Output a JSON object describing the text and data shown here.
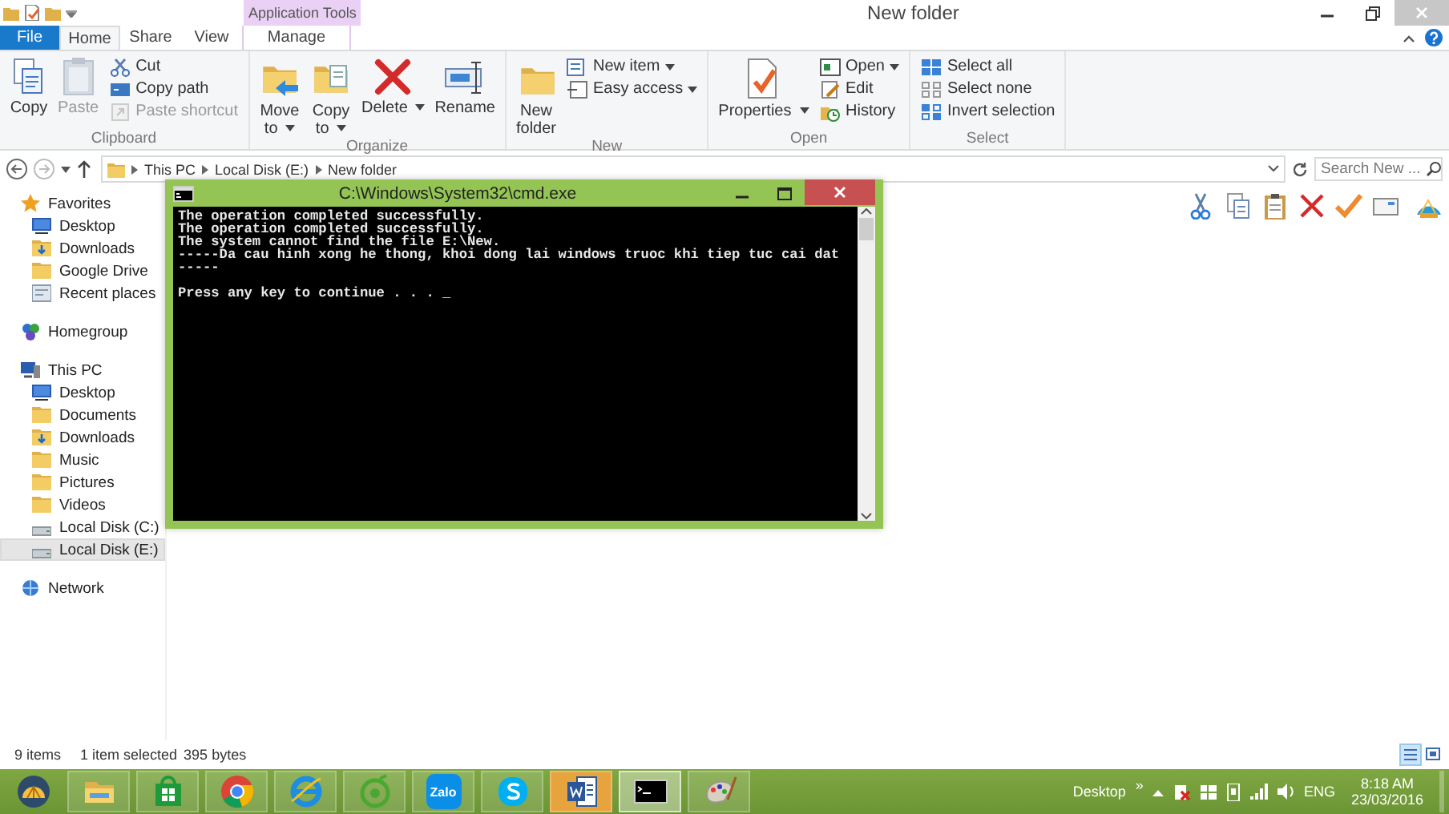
{
  "window": {
    "title": "New folder"
  },
  "context_group": {
    "label": "Application Tools"
  },
  "tabs": [
    {
      "label": "File",
      "kind": "file",
      "selected": false
    },
    {
      "label": "Home",
      "kind": "normal",
      "selected": true
    },
    {
      "label": "Share",
      "kind": "normal",
      "selected": false
    },
    {
      "label": "View",
      "kind": "normal",
      "selected": false
    },
    {
      "label": "Manage",
      "kind": "contextual",
      "selected": false
    }
  ],
  "ribbon": [
    {
      "name": "Clipboard",
      "items": [
        {
          "label": "Copy",
          "kind": "large",
          "disabled": false,
          "dropdown": false
        },
        {
          "label": "Paste",
          "kind": "large",
          "disabled": true,
          "dropdown": false
        },
        {
          "label": "Cut",
          "kind": "small",
          "disabled": false,
          "dropdown": false
        },
        {
          "label": "Copy path",
          "kind": "small",
          "disabled": false,
          "dropdown": false
        },
        {
          "label": "Paste shortcut",
          "kind": "small",
          "disabled": true,
          "dropdown": false
        }
      ]
    },
    {
      "name": "Organize",
      "items": [
        {
          "label": "Move to",
          "kind": "large",
          "disabled": false,
          "dropdown": true
        },
        {
          "label": "Copy to",
          "kind": "large",
          "disabled": false,
          "dropdown": true
        },
        {
          "label": "Delete",
          "kind": "large",
          "disabled": false,
          "dropdown": true
        },
        {
          "label": "Rename",
          "kind": "large",
          "disabled": false,
          "dropdown": false
        }
      ]
    },
    {
      "name": "New",
      "items": [
        {
          "label": "New folder",
          "kind": "large",
          "disabled": false,
          "dropdown": false
        },
        {
          "label": "New item",
          "kind": "small",
          "disabled": false,
          "dropdown": true
        },
        {
          "label": "Easy access",
          "kind": "small",
          "disabled": false,
          "dropdown": true
        }
      ]
    },
    {
      "name": "Open",
      "items": [
        {
          "label": "Properties",
          "kind": "large",
          "disabled": false,
          "dropdown": true
        },
        {
          "label": "Open",
          "kind": "small",
          "disabled": false,
          "dropdown": true
        },
        {
          "label": "Edit",
          "kind": "small",
          "disabled": false,
          "dropdown": false
        },
        {
          "label": "History",
          "kind": "small",
          "disabled": false,
          "dropdown": false
        }
      ]
    },
    {
      "name": "Select",
      "items": [
        {
          "label": "Select all",
          "kind": "small",
          "disabled": false,
          "dropdown": false
        },
        {
          "label": "Select none",
          "kind": "small",
          "disabled": false,
          "dropdown": false
        },
        {
          "label": "Invert selection",
          "kind": "small",
          "disabled": false,
          "dropdown": false
        }
      ]
    }
  ],
  "address": {
    "breadcrumbs": [
      "This PC",
      "Local Disk (E:)",
      "New folder"
    ],
    "search": {
      "placeholder": "Search New ..."
    }
  },
  "navigation": [
    {
      "label": "Favorites",
      "kind": "star",
      "selected": false,
      "children": [
        {
          "label": "Desktop",
          "kind": "desktop",
          "selected": false
        },
        {
          "label": "Downloads",
          "kind": "downloads",
          "selected": false
        },
        {
          "label": "Google Drive",
          "kind": "folder",
          "selected": false
        },
        {
          "label": "Recent places",
          "kind": "recent",
          "selected": false
        }
      ]
    },
    {
      "label": "Homegroup",
      "kind": "homegroup",
      "selected": false
    },
    {
      "label": "This PC",
      "kind": "pc",
      "selected": false,
      "children": [
        {
          "label": "Desktop",
          "kind": "desktop",
          "selected": false
        },
        {
          "label": "Documents",
          "kind": "folder",
          "selected": false
        },
        {
          "label": "Downloads",
          "kind": "downloads",
          "selected": false
        },
        {
          "label": "Music",
          "kind": "folder",
          "selected": false
        },
        {
          "label": "Pictures",
          "kind": "folder",
          "selected": false
        },
        {
          "label": "Videos",
          "kind": "folder",
          "selected": false
        },
        {
          "label": "Local Disk (C:)",
          "kind": "drive",
          "selected": false
        },
        {
          "label": "Local Disk (E:)",
          "kind": "drive",
          "selected": true
        }
      ]
    },
    {
      "label": "Network",
      "kind": "network",
      "selected": false
    }
  ],
  "console": {
    "title": "C:\\Windows\\System32\\cmd.exe",
    "lines": [
      "The operation completed successfully.",
      "The operation completed successfully.",
      "The system cannot find the file E:\\New.",
      "-----Da cau hinh xong he thong, khoi dong lai windows truoc khi tiep tuc cai dat",
      "-----"
    ],
    "prompt": "Press any key to continue . . . _"
  },
  "status_bar": {
    "items": "9 items",
    "selection": "1 item selected",
    "size": "395 bytes"
  },
  "taskbar": {
    "apps": [
      {
        "kind": "start",
        "active": false
      },
      {
        "kind": "explorer",
        "active": false
      },
      {
        "kind": "store",
        "active": false
      },
      {
        "kind": "chrome",
        "active": false
      },
      {
        "kind": "ie",
        "active": false
      },
      {
        "kind": "orbit",
        "active": false
      },
      {
        "kind": "zalo",
        "label": "Zalo",
        "active": false
      },
      {
        "kind": "skype",
        "active": false
      },
      {
        "kind": "word",
        "active": false
      },
      {
        "kind": "cmd",
        "active": true
      },
      {
        "kind": "paint",
        "active": false
      }
    ],
    "desktop_label": "Desktop",
    "chevron": "»",
    "language": "ENG",
    "time": "8:18 AM",
    "date": "23/03/2016"
  }
}
